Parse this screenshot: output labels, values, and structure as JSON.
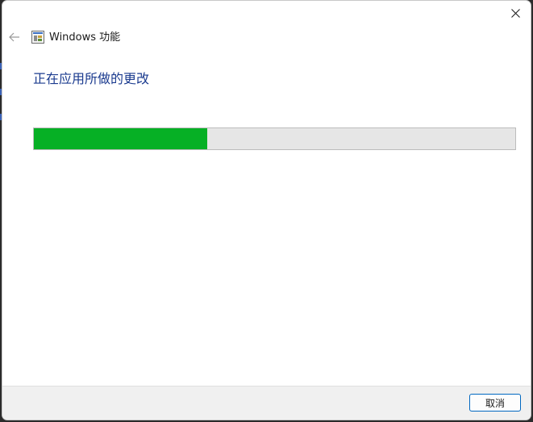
{
  "window": {
    "title": "Windows 功能",
    "heading": "正在应用所做的更改"
  },
  "progress": {
    "value": 0.36,
    "fill_color": "#06b025",
    "track_color": "#e6e6e6"
  },
  "buttons": {
    "cancel_label": "取消",
    "close_icon": "close-icon",
    "back_icon": "back-arrow-icon"
  },
  "colors": {
    "heading": "#1b3b8f",
    "accent": "#0067c0"
  }
}
